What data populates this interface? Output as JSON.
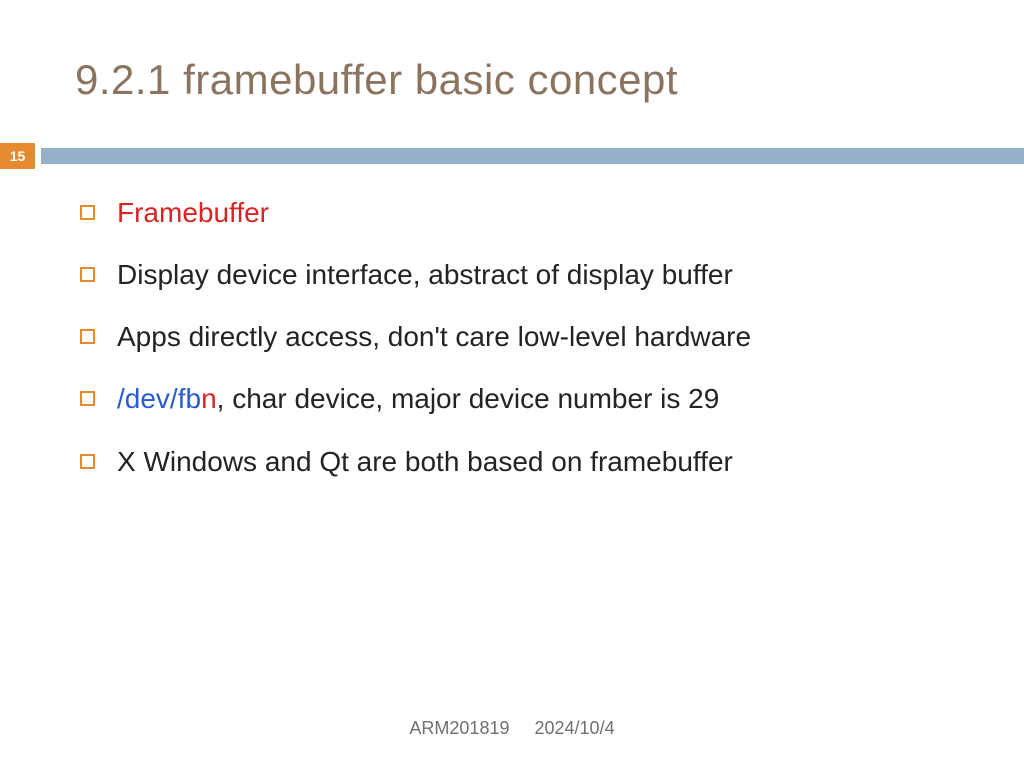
{
  "title": "9.2.1 framebuffer basic concept",
  "pageNumber": "15",
  "bullets": [
    {
      "spans": [
        {
          "t": "Framebuffer",
          "c": "c-red"
        }
      ]
    },
    {
      "spans": [
        {
          "t": "Display device interface, abstract of display buffer",
          "c": ""
        }
      ]
    },
    {
      "spans": [
        {
          "t": "Apps directly access, don't care low-level hardware",
          "c": ""
        }
      ]
    },
    {
      "spans": [
        {
          "t": "/dev/fb",
          "c": "c-blue"
        },
        {
          "t": "n",
          "c": "c-red"
        },
        {
          "t": ", char device, major device number is 29",
          "c": ""
        }
      ]
    },
    {
      "spans": [
        {
          "t": "X Windows and Qt are both based on framebuffer",
          "c": ""
        }
      ]
    }
  ],
  "footer": {
    "course": "ARM201819",
    "date": "2024/10/4"
  }
}
